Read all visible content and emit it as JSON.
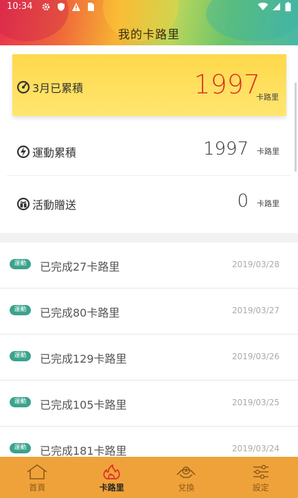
{
  "status_bar": {
    "time": "10:34",
    "icons": [
      "gear-icon",
      "shield-icon",
      "warning-icon",
      "sim-icon",
      "wifi-icon",
      "signal-icon",
      "battery-icon"
    ]
  },
  "header": {
    "title": "我的卡路里"
  },
  "summary": {
    "monthly": {
      "label": "3月已累積",
      "value": "1997",
      "unit": "卡路里",
      "value_color": "#d9312b"
    },
    "exercise": {
      "label": "運動累積",
      "value": "1997",
      "unit": "卡路里"
    },
    "gift": {
      "label": "活動贈送",
      "value": "0",
      "unit": "卡路里"
    }
  },
  "list": {
    "items": [
      {
        "badge": "運動",
        "text": "已完成27卡路里",
        "date": "2019/03/28"
      },
      {
        "badge": "運動",
        "text": "已完成80卡路里",
        "date": "2019/03/27"
      },
      {
        "badge": "運動",
        "text": "已完成129卡路里",
        "date": "2019/03/26"
      },
      {
        "badge": "運動",
        "text": "已完成105卡路里",
        "date": "2019/03/25"
      },
      {
        "badge": "運動",
        "text": "已完成181卡路里",
        "date": "2019/03/24"
      }
    ]
  },
  "nav": {
    "items": [
      {
        "label": "首頁",
        "icon": "home-icon",
        "active": false
      },
      {
        "label": "卡路里",
        "icon": "flame-icon",
        "active": true
      },
      {
        "label": "兌換",
        "icon": "exchange-icon",
        "active": false
      },
      {
        "label": "設定",
        "icon": "settings-sliders-icon",
        "active": false
      }
    ]
  },
  "colors": {
    "accent": "#f0a23a",
    "highlight": "#ffde55",
    "badge": "#3aa38c"
  }
}
